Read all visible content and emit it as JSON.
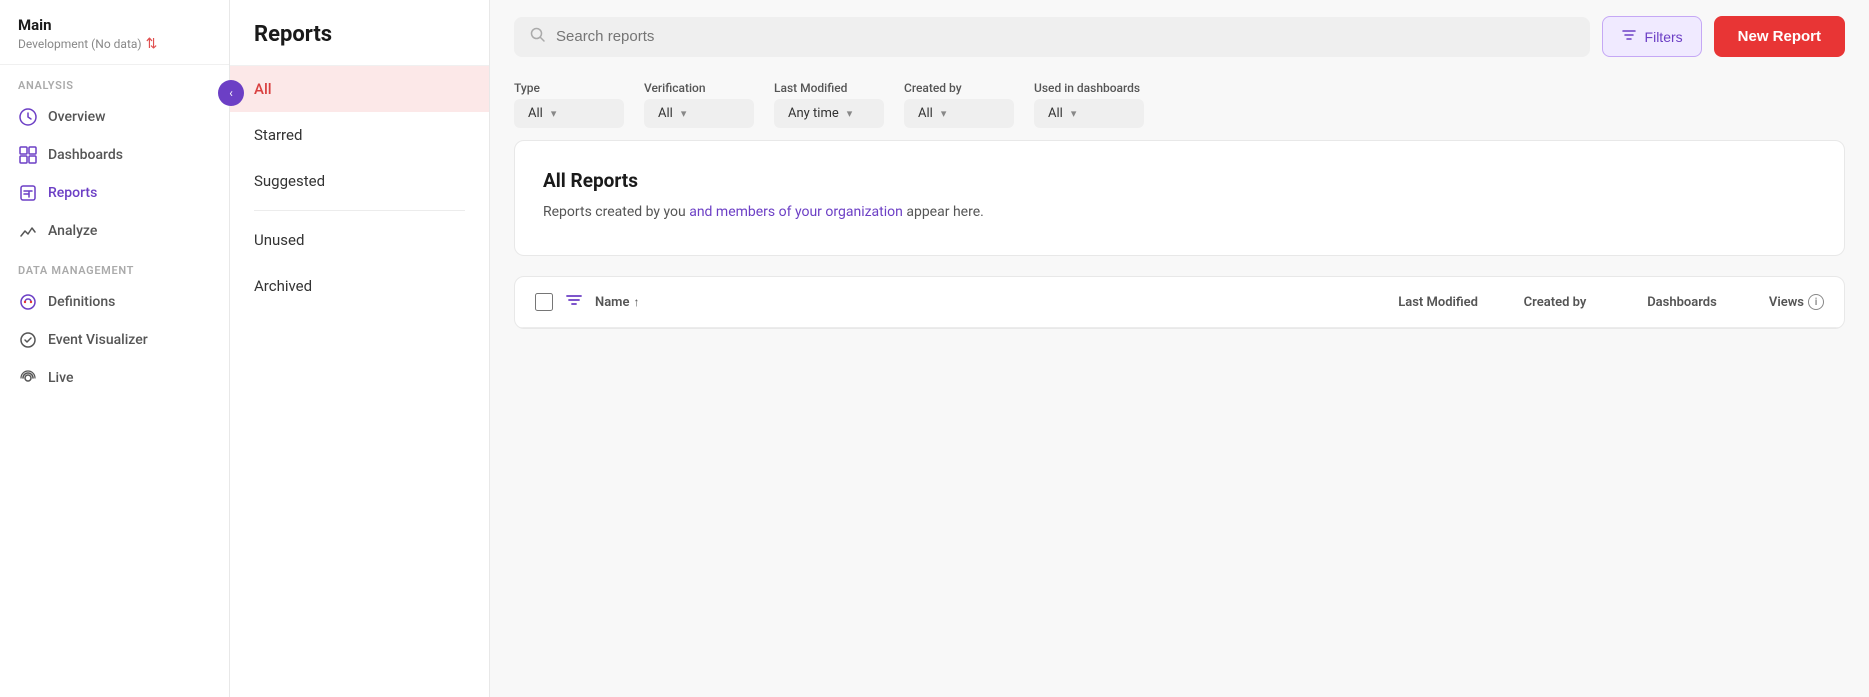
{
  "sidebar": {
    "app_name": "Main",
    "app_sub": "Development (No data)",
    "collapse_icon": "‹",
    "sections": [
      {
        "label": "Analysis",
        "items": [
          {
            "id": "overview",
            "label": "Overview",
            "icon": "⬡"
          },
          {
            "id": "dashboards",
            "label": "Dashboards",
            "icon": "▦"
          },
          {
            "id": "reports",
            "label": "Reports",
            "icon": "📊",
            "active": true
          },
          {
            "id": "analyze",
            "label": "Analyze",
            "icon": "📈"
          }
        ]
      },
      {
        "label": "Data Management",
        "items": [
          {
            "id": "definitions",
            "label": "Definitions",
            "icon": "🏷"
          },
          {
            "id": "event-visualizer",
            "label": "Event Visualizer",
            "icon": "✔"
          },
          {
            "id": "live",
            "label": "Live",
            "icon": "📡"
          }
        ]
      }
    ]
  },
  "report_categories": {
    "title": "Reports",
    "items": [
      {
        "id": "all",
        "label": "All",
        "active": true
      },
      {
        "id": "starred",
        "label": "Starred"
      },
      {
        "id": "suggested",
        "label": "Suggested"
      },
      {
        "id": "unused",
        "label": "Unused"
      },
      {
        "id": "archived",
        "label": "Archived"
      }
    ]
  },
  "toolbar": {
    "search_placeholder": "Search reports",
    "filters_label": "Filters",
    "new_report_label": "New Report"
  },
  "filters": {
    "type": {
      "label": "Type",
      "value": "All"
    },
    "verification": {
      "label": "Verification",
      "value": "All"
    },
    "last_modified": {
      "label": "Last Modified",
      "value": "Any time"
    },
    "created_by": {
      "label": "Created by",
      "value": "All"
    },
    "used_in_dashboards": {
      "label": "Used in dashboards",
      "value": "All"
    }
  },
  "all_reports": {
    "title": "All Reports",
    "description_plain": "Reports created by you ",
    "description_link": "and members of your organization",
    "description_suffix": " appear here."
  },
  "table": {
    "col_name": "Name",
    "col_sort_icon": "↑",
    "col_last_modified": "Last Modified",
    "col_created_by": "Created by",
    "col_dashboards": "Dashboards",
    "col_views": "Views",
    "rows": []
  }
}
